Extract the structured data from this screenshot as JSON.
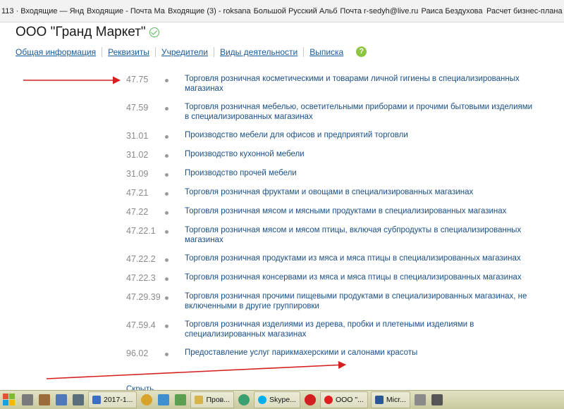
{
  "bookmarks": [
    "113 · Входящие — Янд",
    "Входящие - Почта Ма",
    "Входящие (3) - roksana",
    "Большой Русский Альб",
    "Почта r-sedyh@live.ru",
    "Раиса Бездухова",
    "Расчет бизнес-плана"
  ],
  "company": {
    "name": "ООО \"Гранд Маркет\""
  },
  "tabs": [
    "Общая информация",
    "Реквизиты",
    "Учредители",
    "Виды деятельности",
    "Выписка"
  ],
  "help_label": "?",
  "activities": [
    {
      "code": "47.75",
      "desc": "Торговля розничная косметическими и товарами личной гигиены в специализированных магазинах"
    },
    {
      "code": "47.59",
      "desc": "Торговля розничная мебелью, осветительными приборами и прочими бытовыми изделиями в специализированных магазинах"
    },
    {
      "code": "31.01",
      "desc": "Производство мебели для офисов и предприятий торговли"
    },
    {
      "code": "31.02",
      "desc": "Производство кухонной мебели"
    },
    {
      "code": "31.09",
      "desc": "Производство прочей мебели"
    },
    {
      "code": "47.21",
      "desc": "Торговля розничная фруктами и овощами в специализированных магазинах"
    },
    {
      "code": "47.22",
      "desc": "Торговля розничная мясом и мясными продуктами в специализированных магазинах"
    },
    {
      "code": "47.22.1",
      "desc": "Торговля розничная мясом и мясом птицы, включая субпродукты в специализированных магазинах"
    },
    {
      "code": "47.22.2",
      "desc": "Торговля розничная продуктами из мяса и мяса птицы в специализированных магазинах"
    },
    {
      "code": "47.22.3",
      "desc": "Торговля розничная консервами из мяса и мяса птицы в специализированных магазинах"
    },
    {
      "code": "47.29.39",
      "desc": "Торговля розничная прочими пищевыми продуктами в специализированных магазинах, не включенными в другие группировки"
    },
    {
      "code": "47.59.4",
      "desc": "Торговля розничная изделиями из дерева, пробки и плетеными изделиями в специализированных магазинах"
    },
    {
      "code": "96.02",
      "desc": "Предоставление услуг парикмахерскими и салонами красоты"
    }
  ],
  "hide_link": "Скрыть",
  "taskbar": {
    "items": [
      "2017-1...",
      "Пров...",
      "Skype...",
      "ООО \"...",
      "Micr..."
    ]
  },
  "colors": {
    "link": "#1a5a96",
    "code": "#8a8a8a",
    "arrow": "#d62020",
    "verified": "#5cb85c",
    "help": "#8cc63f"
  }
}
